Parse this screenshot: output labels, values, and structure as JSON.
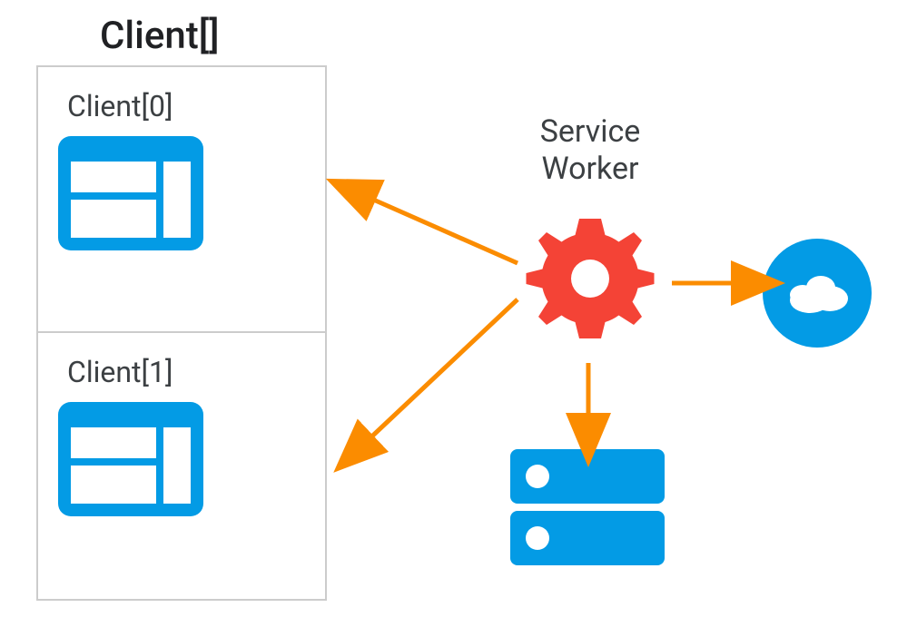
{
  "title": "Client[]",
  "clients": [
    {
      "label": "Client[0]"
    },
    {
      "label": "Client[1]"
    }
  ],
  "service_worker_label_1": "Service",
  "service_worker_label_2": "Worker",
  "colors": {
    "blue": "#039be5",
    "red": "#f44336",
    "orange": "#fb8c00",
    "text": "#3c4043",
    "border": "#ccc"
  },
  "nodes": {
    "clients_array": {
      "type": "container",
      "contains": [
        "client0",
        "client1"
      ]
    },
    "client0": {
      "type": "browser-window"
    },
    "client1": {
      "type": "browser-window"
    },
    "service_worker": {
      "type": "gear"
    },
    "cache_server": {
      "type": "server"
    },
    "network_cloud": {
      "type": "cloud"
    }
  },
  "edges": [
    {
      "from": "service_worker",
      "to": "client0",
      "dir": "bidirectional"
    },
    {
      "from": "service_worker",
      "to": "client1",
      "dir": "bidirectional"
    },
    {
      "from": "service_worker",
      "to": "cache_server",
      "dir": "one"
    },
    {
      "from": "service_worker",
      "to": "network_cloud",
      "dir": "one"
    }
  ]
}
